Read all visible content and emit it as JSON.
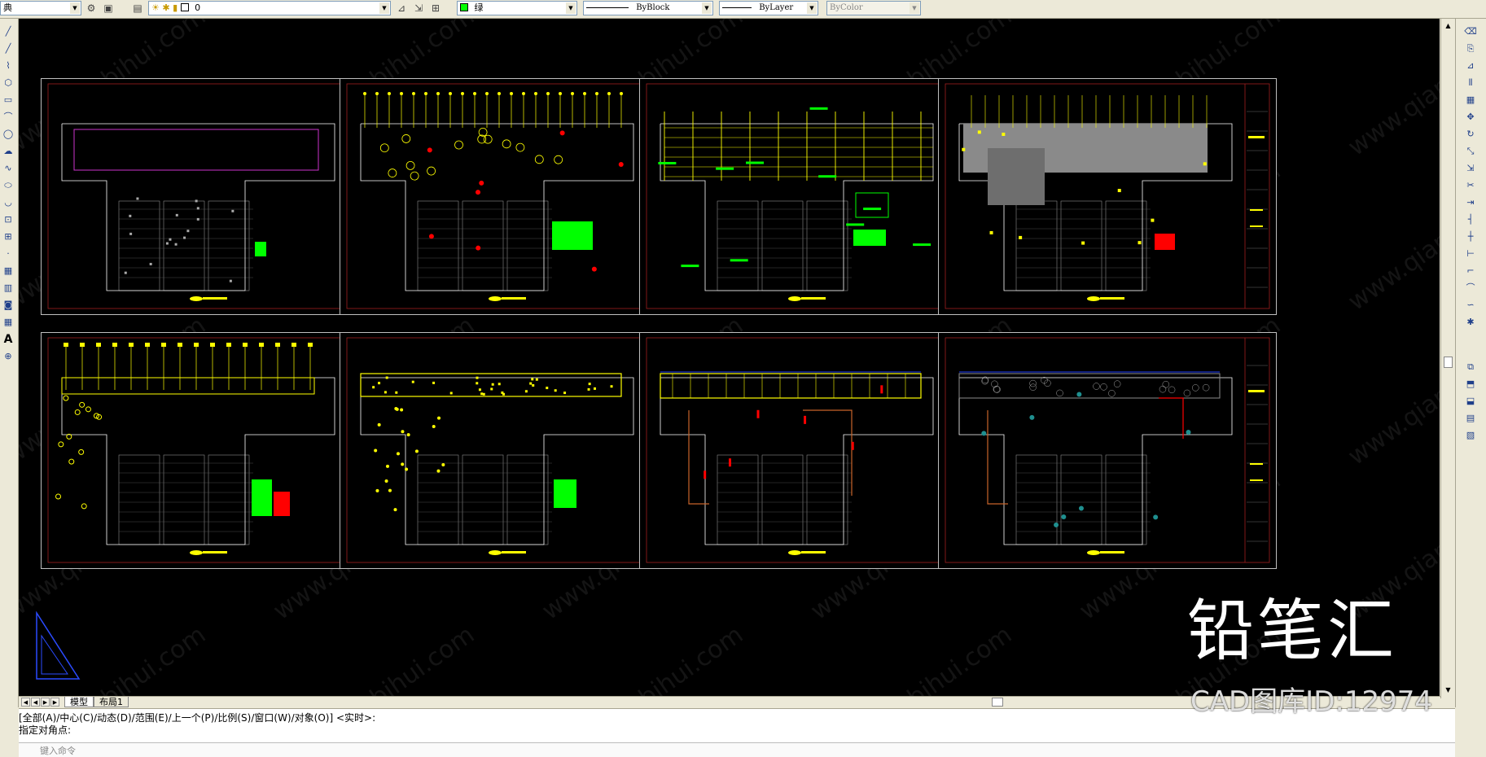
{
  "toolbar": {
    "workspace_label": "典",
    "layer_name": "0",
    "color_label": "绿",
    "color_hex": "#00ff00",
    "linetype_label": "ByBlock",
    "lineweight_label": "ByLayer",
    "plotstyle_label": "ByColor"
  },
  "icons": {
    "left": [
      "line-icon",
      "construction-line-icon",
      "polyline-icon",
      "polygon-icon",
      "rectangle-icon",
      "arc-icon",
      "circle-icon",
      "revision-cloud-icon",
      "spline-icon",
      "ellipse-icon",
      "ellipse-arc-icon",
      "insert-block-icon",
      "make-block-icon",
      "point-icon",
      "hatch-icon",
      "gradient-icon",
      "region-icon",
      "table-icon",
      "multiline-text-icon",
      "add-selected-icon"
    ],
    "right": [
      "erase-icon",
      "copy-icon",
      "mirror-icon",
      "offset-icon",
      "array-icon",
      "move-icon",
      "rotate-icon",
      "scale-icon",
      "stretch-icon",
      "trim-icon",
      "extend-icon",
      "break-at-point-icon",
      "break-icon",
      "join-icon",
      "chamfer-icon",
      "fillet-icon",
      "blend-icon",
      "explode-icon",
      "draworder-icon",
      "bring-front-icon",
      "send-back-icon",
      "text-front-icon",
      "hatch-back-icon"
    ]
  },
  "sheets": [
    {
      "id": "sheet-1",
      "variant": "demolition"
    },
    {
      "id": "sheet-2",
      "variant": "lighting"
    },
    {
      "id": "sheet-3",
      "variant": "wall"
    },
    {
      "id": "sheet-4",
      "variant": "ceiling"
    },
    {
      "id": "sheet-5",
      "variant": "electrical"
    },
    {
      "id": "sheet-6",
      "variant": "furniture"
    },
    {
      "id": "sheet-7",
      "variant": "plan"
    },
    {
      "id": "sheet-8",
      "variant": "layout"
    }
  ],
  "colors": {
    "yellow": "#ffff00",
    "green": "#00ff00",
    "red": "#ff0000",
    "white": "#ffffff",
    "blue": "#2040ff",
    "magenta": "#cc33cc",
    "orange": "#c8642a",
    "grey": "#8c8c8c"
  },
  "tabs": {
    "model": "模型",
    "layout1": "布局1"
  },
  "command": {
    "history1": "[全部(A)/中心(C)/动态(D)/范围(E)/上一个(P)/比例(S)/窗口(W)/对象(O)] <实时>:",
    "history2": "指定对角点:",
    "placeholder": "键入命令"
  },
  "watermark": {
    "brand": "铅笔汇",
    "id_text": "CAD图库ID:12974",
    "tile_text": "www.qianbihui.com"
  }
}
